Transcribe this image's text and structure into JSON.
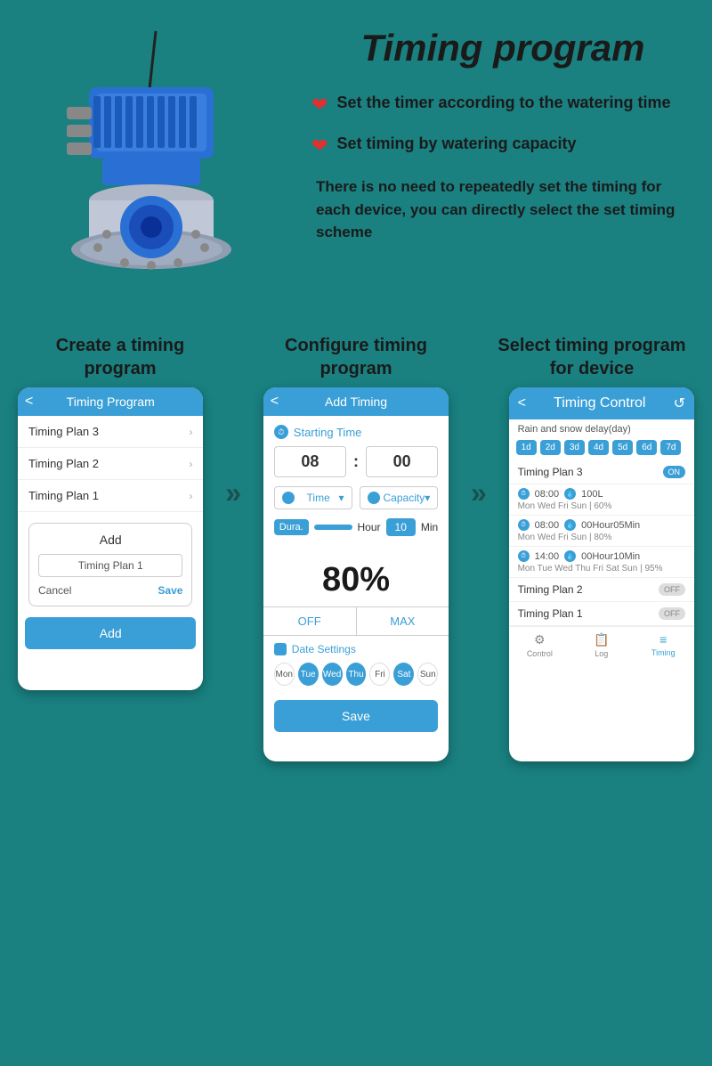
{
  "page": {
    "title": "Timing program",
    "background_color": "#1a8080"
  },
  "top_section": {
    "bullets": [
      {
        "icon": "❤",
        "text": "Set the timer according to the watering time"
      },
      {
        "icon": "❤",
        "text": "Set timing by watering capacity"
      }
    ],
    "description": "There is no need to repeatedly set the timing for each device, you can directly select the set timing scheme"
  },
  "steps": [
    {
      "title": "Create a timing program",
      "phone": {
        "header": "Timing Program",
        "list": [
          "Timing Plan 3",
          "Timing Plan 2",
          "Timing Plan 1"
        ],
        "add_label": "Add",
        "input_placeholder": "Timing Plan 1",
        "cancel_btn": "Cancel",
        "save_btn": "Save",
        "bottom_btn": "Add"
      }
    },
    {
      "title": "Configure timing program",
      "phone": {
        "header": "Add Timing",
        "starting_time_label": "Starting Time",
        "hour": "08",
        "minute": "00",
        "time_dropdown": "Time",
        "capacity_dropdown": "Capacity",
        "dura_label": "Dura.",
        "hour_label": "Hour",
        "min_value": "10",
        "min_label": "Min",
        "percent": "80%",
        "off_label": "OFF",
        "max_label": "MAX",
        "date_label": "Date Settings",
        "days": [
          "Mon",
          "Tue",
          "Wed",
          "Thu",
          "Fri",
          "Sat",
          "Sun"
        ],
        "active_days": [
          1,
          2,
          3,
          4,
          5,
          6
        ],
        "save_btn": "Save"
      }
    },
    {
      "title": "Select timing program for device",
      "phone": {
        "header": "Timing Control",
        "rain_label": "Rain and snow delay(day)",
        "day_buttons": [
          "1d",
          "2d",
          "3d",
          "4d",
          "5d",
          "6d",
          "7d"
        ],
        "plans": [
          {
            "name": "Timing Plan 3",
            "toggle": "ON",
            "schedules": [
              {
                "time": "08:00",
                "value": "100L",
                "days": "Mon Wed Fri Sun | 60%"
              },
              {
                "time": "08:00",
                "value": "00Hour05Min",
                "days": "Mon Wed Fri Sun | 80%"
              },
              {
                "time": "14:00",
                "value": "00Hour10Min",
                "days": "Mon Tue Wed Thu Fri Sat Sun | 95%"
              }
            ]
          },
          {
            "name": "Timing Plan 2",
            "toggle": "OFF"
          },
          {
            "name": "Timing Plan 1",
            "toggle": "OFF"
          }
        ],
        "nav": [
          "Control",
          "Log",
          "Timing"
        ]
      }
    }
  ],
  "arrows": [
    "»",
    "»"
  ]
}
